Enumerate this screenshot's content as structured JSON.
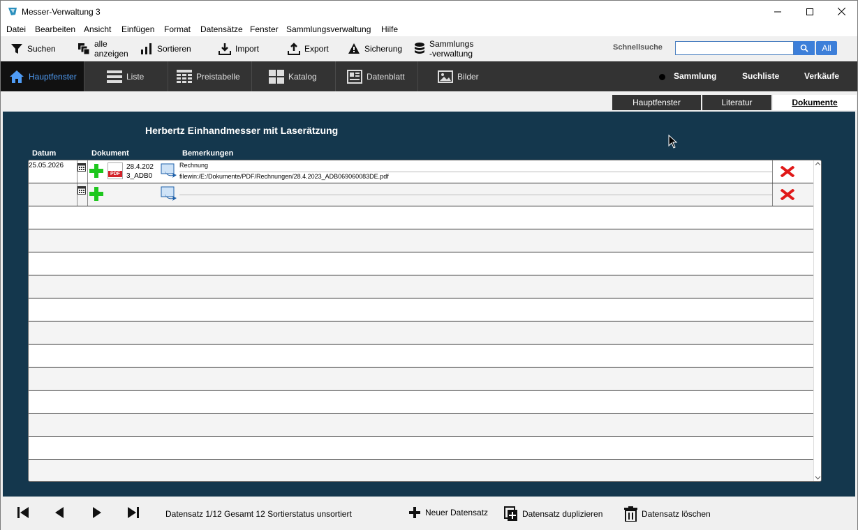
{
  "window": {
    "title": "Messer-Verwaltung 3"
  },
  "menu": [
    "Datei",
    "Bearbeiten",
    "Ansicht",
    "Einfügen",
    "Format",
    "Datensätze",
    "Fenster",
    "Sammlungsverwaltung",
    "Hilfe"
  ],
  "toolbar": {
    "search": "Suchen",
    "show_all_1": "alle",
    "show_all_2": "anzeigen",
    "sort": "Sortieren",
    "import": "Import",
    "export": "Export",
    "backup": "Sicherung",
    "collection_1": "Sammlungs",
    "collection_2": "-verwaltung",
    "quick_label": "Schnellsuche",
    "quick_value": "",
    "all": "All"
  },
  "nav": {
    "items": [
      "Hauptfenster",
      "Liste",
      "Preistabelle",
      "Katalog",
      "Datenblatt",
      "Bilder"
    ],
    "right": [
      "Sammlung",
      "Suchliste",
      "Verkäufe"
    ],
    "active_color": "#4f9cf5"
  },
  "subtabs": [
    "Hauptfenster",
    "Literatur",
    "Dokumente"
  ],
  "record": {
    "title": "Herbertz Einhandmesser mit Laserätzung",
    "headers": {
      "date": "Datum",
      "document": "Dokument",
      "remarks": "Bemerkungen"
    },
    "rows": [
      {
        "date": "25.05.2026",
        "doc_line1": "28.4.202",
        "doc_line2": "3_ADB0",
        "pdf_label": "PDF",
        "remark1": "Rechnung",
        "remark2": "filewin:/E:/Dokumente/PDF/Rechnungen/28.4.2023_ADB069060083DE.pdf"
      }
    ]
  },
  "status": {
    "text": "Datensatz 1/12 Gesamt 12  Sortierstatus unsortiert",
    "new": "Neuer Datensatz",
    "duplicate": "Datensatz duplizieren",
    "delete": "Datensatz löschen"
  },
  "colors": {
    "main_bg": "#14374d",
    "nav_bg": "#333333",
    "accent": "#3d7fd9"
  }
}
